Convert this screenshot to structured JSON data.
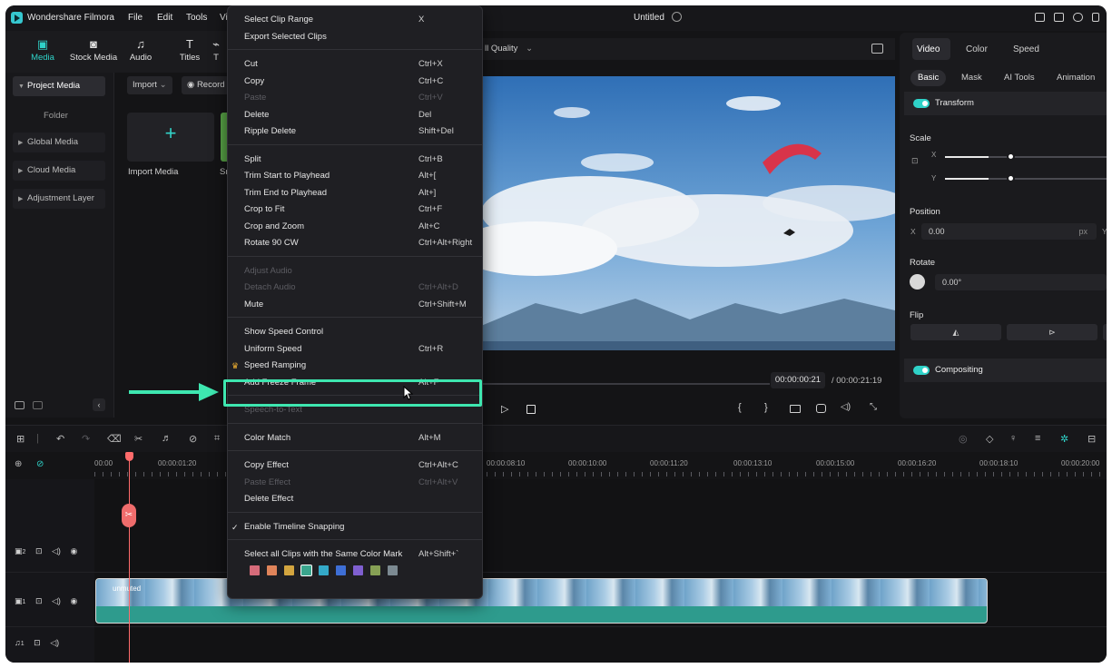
{
  "app": {
    "name": "Wondershare Filmora",
    "menus": [
      "File",
      "Edit",
      "Tools",
      "Vi"
    ],
    "document_title": "Untitled"
  },
  "media_tabs": [
    {
      "label": "Media",
      "icon": "media-icon",
      "glyph": "▣"
    },
    {
      "label": "Stock Media",
      "icon": "stock-media-icon",
      "glyph": "◙"
    },
    {
      "label": "Audio",
      "icon": "music-note-icon",
      "glyph": "♫"
    },
    {
      "label": "Titles",
      "icon": "titles-icon",
      "glyph": "T"
    },
    {
      "label": "T",
      "icon": "transitions-icon",
      "glyph": "⌁"
    }
  ],
  "sidebar": {
    "items": [
      {
        "label": "Project Media",
        "caret": "▼"
      },
      {
        "label": "Global Media",
        "caret": "▶"
      },
      {
        "label": "Cloud Media",
        "caret": "▶"
      },
      {
        "label": "Adjustment Layer",
        "caret": "▶"
      }
    ],
    "folder": "Folder"
  },
  "media_area": {
    "import_button": "Import",
    "record_button": "Record",
    "import_tile_label": "Import Media",
    "partial_label": "Sr"
  },
  "player": {
    "quality": "ll Quality",
    "current_time": "00:00:00:21",
    "total_time": "/ 00:00:21:19"
  },
  "right_panel": {
    "tabs": [
      "Video",
      "Color",
      "Speed"
    ],
    "subtabs": [
      "Basic",
      "Mask",
      "AI Tools",
      "Animation"
    ],
    "transform": "Transform",
    "scale": "Scale",
    "scale_x_label": "X",
    "scale_y_label": "Y",
    "position": "Position",
    "position_x_label": "X",
    "position_x": "0.00",
    "position_unit": "px",
    "position_y_label": "Y",
    "rotate": "Rotate",
    "rotate_value": "0.00°",
    "flip": "Flip",
    "compositing": "Compositing",
    "scale_x_level": 0.27,
    "scale_y_level": 0.27
  },
  "timeline": {
    "ruler_ticks": [
      "00:00",
      "00:00:01:20",
      "00:00:08:10",
      "00:00:10:00",
      "00:00:11:20",
      "00:00:13:10",
      "00:00:15:00",
      "00:00:16:20",
      "00:00:18:10",
      "00:00:20:00"
    ],
    "clip_title": "unmuted",
    "track_labels": [
      "2",
      "1",
      "1"
    ]
  },
  "context_menu": {
    "items": [
      {
        "label": "Select Clip Range",
        "shortcut": "X",
        "disabled": false
      },
      {
        "label": "Export Selected Clips",
        "shortcut": "",
        "disabled": false
      },
      {
        "sep": true
      },
      {
        "label": "Cut",
        "shortcut": "Ctrl+X",
        "disabled": false
      },
      {
        "label": "Copy",
        "shortcut": "Ctrl+C",
        "disabled": false
      },
      {
        "label": "Paste",
        "shortcut": "Ctrl+V",
        "disabled": true
      },
      {
        "label": "Delete",
        "shortcut": "Del",
        "disabled": false
      },
      {
        "label": "Ripple Delete",
        "shortcut": "Shift+Del",
        "disabled": false
      },
      {
        "sep": true
      },
      {
        "label": "Split",
        "shortcut": "Ctrl+B",
        "disabled": false
      },
      {
        "label": "Trim Start to Playhead",
        "shortcut": "Alt+[",
        "disabled": false
      },
      {
        "label": "Trim End to Playhead",
        "shortcut": "Alt+]",
        "disabled": false
      },
      {
        "label": "Crop to Fit",
        "shortcut": "Ctrl+F",
        "disabled": false
      },
      {
        "label": "Crop and Zoom",
        "shortcut": "Alt+C",
        "disabled": false
      },
      {
        "label": "Rotate 90 CW",
        "shortcut": "Ctrl+Alt+Right",
        "disabled": false
      },
      {
        "sep": true
      },
      {
        "label": "Adjust Audio",
        "shortcut": "",
        "disabled": true
      },
      {
        "label": "Detach Audio",
        "shortcut": "Ctrl+Alt+D",
        "disabled": true
      },
      {
        "label": "Mute",
        "shortcut": "Ctrl+Shift+M",
        "disabled": false
      },
      {
        "sep": true
      },
      {
        "label": "Show Speed Control",
        "shortcut": "",
        "disabled": false
      },
      {
        "label": "Uniform Speed",
        "shortcut": "Ctrl+R",
        "disabled": false
      },
      {
        "label": "Speed Ramping",
        "shortcut": "",
        "disabled": false,
        "crown": true
      },
      {
        "label": "Add Freeze Frame",
        "shortcut": "Alt+F",
        "disabled": false,
        "highlight": true
      },
      {
        "sep": true
      },
      {
        "label": "Speech-to-Text",
        "shortcut": "",
        "disabled": true
      },
      {
        "sep": true
      },
      {
        "label": "Color Match",
        "shortcut": "Alt+M",
        "disabled": false
      },
      {
        "sep": true
      },
      {
        "label": "Copy Effect",
        "shortcut": "Ctrl+Alt+C",
        "disabled": false
      },
      {
        "label": "Paste Effect",
        "shortcut": "Ctrl+Alt+V",
        "disabled": true
      },
      {
        "label": "Delete Effect",
        "shortcut": "",
        "disabled": false
      },
      {
        "sep": true
      },
      {
        "label": "Enable Timeline Snapping",
        "shortcut": "",
        "disabled": false,
        "check": true
      },
      {
        "sep": true
      },
      {
        "label": "Select all Clips with the Same Color Mark",
        "shortcut": "Alt+Shift+`",
        "disabled": false
      }
    ],
    "color_marks": [
      "#d66b7a",
      "#e0845a",
      "#d3a53f",
      "#3aa58d",
      "#34a9c8",
      "#3e6fd6",
      "#7f5fd0",
      "#86a055",
      "#7c8a92"
    ],
    "check_glyph": "✓",
    "crown_glyph": "♛"
  },
  "colors": {
    "accent": "#2fd2c8",
    "highlight": "#3ee7b0",
    "playhead": "#ff6b6b"
  }
}
